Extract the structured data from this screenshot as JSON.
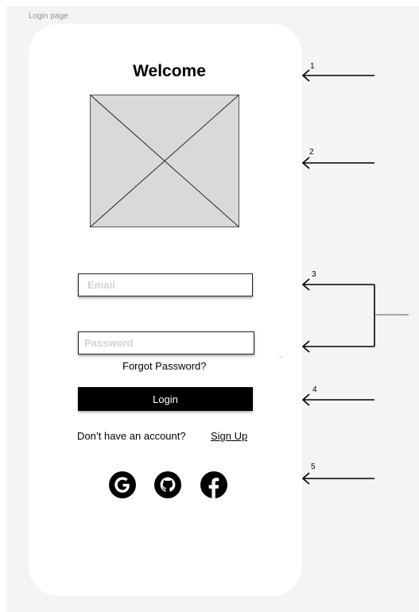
{
  "frame": {
    "label": "Login page"
  },
  "login": {
    "title": "Welcome",
    "email_placeholder": "Email",
    "password_placeholder": "Password",
    "forgot_password": "Forgot Password?",
    "login_button": "Login",
    "no_account_text": "Don’t have an account?",
    "signup_link": "Sign Up",
    "social_icons": [
      "google-icon",
      "github-icon",
      "facebook-icon"
    ]
  },
  "annotations": {
    "numbers": [
      "1",
      "2",
      "3",
      "4",
      "5"
    ],
    "ellipsis": "..."
  },
  "colors": {
    "canvas": "#f4f4f4",
    "card": "#ffffff",
    "primary_button": "#000000",
    "image_placeholder": "#d9d9d9"
  }
}
